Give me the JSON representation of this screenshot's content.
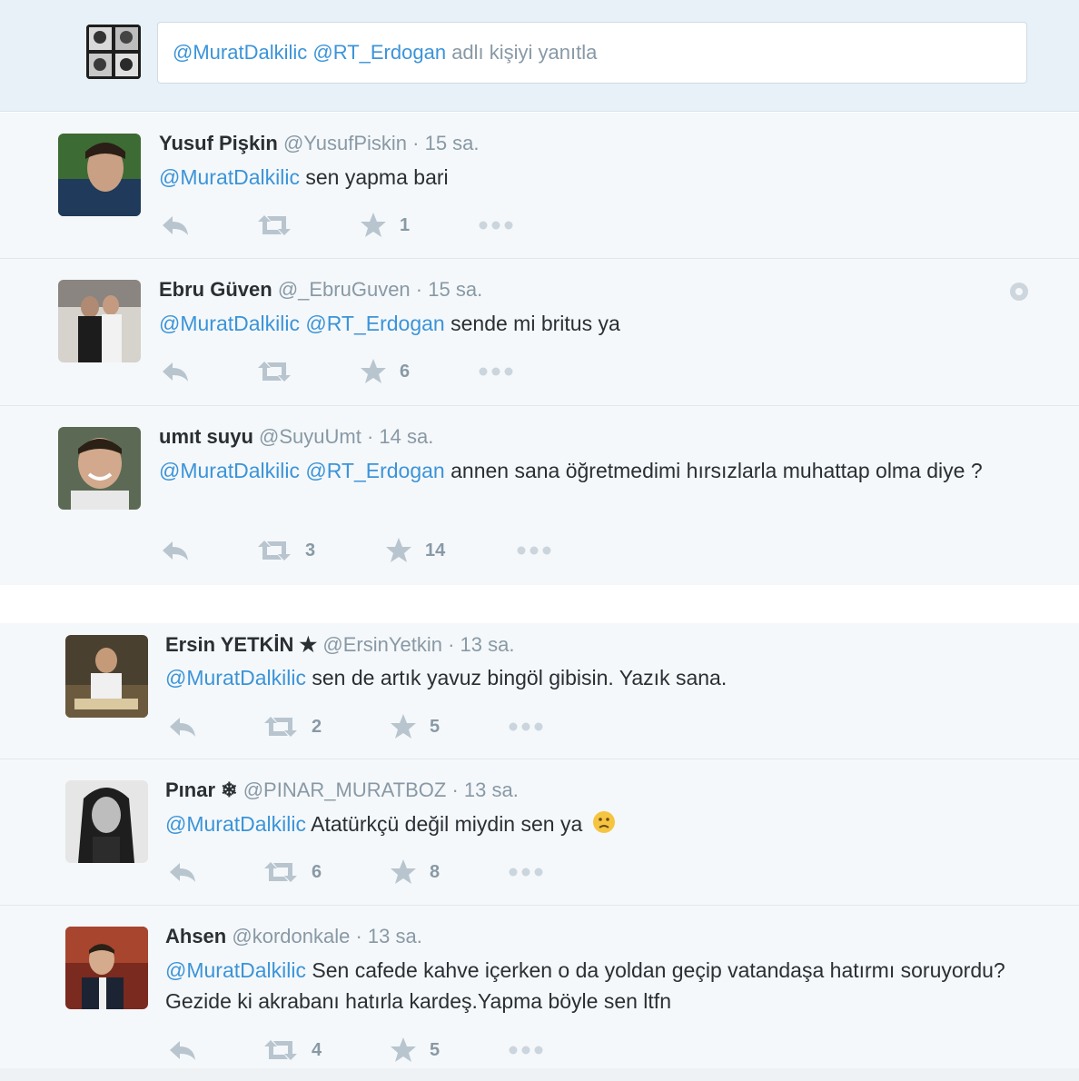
{
  "reply_box": {
    "mention1": "@MuratDalkilic",
    "mention2": "@RT_Erdogan",
    "prompt": "adlı kişiyi yanıtla"
  },
  "tweets": [
    {
      "name": "Yusuf Pişkin",
      "handle": "@YusufPiskin",
      "time": "15 sa.",
      "mentions": [
        "@MuratDalkilic"
      ],
      "text": "sen yapma bari",
      "retweets": "",
      "favorites": "1"
    },
    {
      "name": "Ebru Güven",
      "handle": "@_EbruGuven",
      "time": "15 sa.",
      "mentions": [
        "@MuratDalkilic",
        "@RT_Erdogan"
      ],
      "text": " sende mi britus ya",
      "retweets": "",
      "favorites": "6"
    },
    {
      "name": "umıt suyu ",
      "handle": "@SuyuUmt",
      "time": "14 sa.",
      "mentions": [
        "@MuratDalkilic",
        "@RT_Erdogan"
      ],
      "text": "annen sana öğretmedimi hırsızlarla muhattap olma diye ?",
      "retweets": "3",
      "favorites": "14"
    },
    {
      "name": "Ersin YETKİN ★",
      "handle": "@ErsinYetkin",
      "time": "13 sa.",
      "mentions": [
        "@MuratDalkilic"
      ],
      "text": "sen de artık yavuz bingöl gibisin. Yazık sana.",
      "retweets": "2",
      "favorites": "5"
    },
    {
      "name": "Pınar ❄",
      "handle": "@PINAR_MURATBOZ",
      "time": "13 sa.",
      "mentions": [
        "@MuratDalkilic"
      ],
      "text": "Atatürkçü değil miydin sen ya",
      "retweets": "6",
      "favorites": "8"
    },
    {
      "name": "Ahsen",
      "handle": "@kordonkale",
      "time": "13 sa.",
      "mentions": [
        "@MuratDalkilic"
      ],
      "text": "Sen cafede kahve içerken o da yoldan geçip vatandaşa hatırmı soruyordu?Gezide ki akrabanı hatırla kardeş.Yapma böyle sen ltfn",
      "retweets": "4",
      "favorites": "5"
    }
  ],
  "icons": {
    "reply": "reply-icon",
    "retweet": "retweet-icon",
    "favorite": "star-icon",
    "more": "more-icon",
    "gear": "gear-icon",
    "emoji": "sad-face-icon"
  },
  "colors": {
    "mention": "#3b94d9",
    "muted": "#8899a6",
    "background": "#f5f8fa",
    "reply_bar": "#e8f1f7"
  }
}
